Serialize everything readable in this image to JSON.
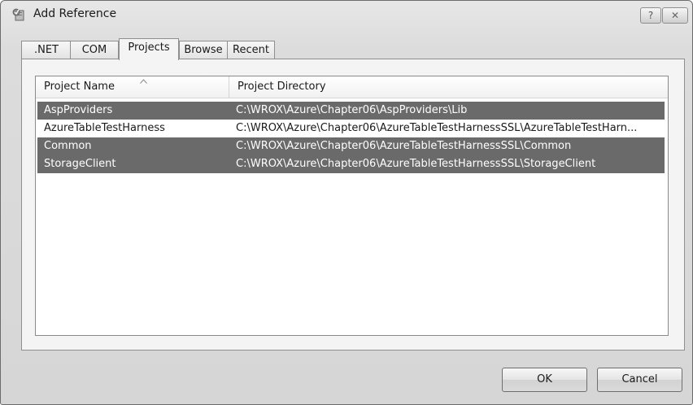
{
  "window": {
    "title": "Add Reference",
    "help_label": "?",
    "close_label": "✕"
  },
  "tabs": [
    {
      "label": ".NET",
      "active": false
    },
    {
      "label": "COM",
      "active": false
    },
    {
      "label": "Projects",
      "active": true
    },
    {
      "label": "Browse",
      "active": false
    },
    {
      "label": "Recent",
      "active": false
    }
  ],
  "list": {
    "columns": {
      "name": "Project Name",
      "directory": "Project Directory"
    },
    "rows": [
      {
        "name": "AspProviders",
        "directory": "C:\\WROX\\Azure\\Chapter06\\AspProviders\\Lib",
        "selected": true
      },
      {
        "name": "AzureTableTestHarness",
        "directory": "C:\\WROX\\Azure\\Chapter06\\AzureTableTestHarnessSSL\\AzureTableTestHarn...",
        "selected": false
      },
      {
        "name": "Common",
        "directory": "C:\\WROX\\Azure\\Chapter06\\AzureTableTestHarnessSSL\\Common",
        "selected": true
      },
      {
        "name": "StorageClient",
        "directory": "C:\\WROX\\Azure\\Chapter06\\AzureTableTestHarnessSSL\\StorageClient",
        "selected": true
      }
    ]
  },
  "buttons": {
    "ok": "OK",
    "cancel": "Cancel"
  },
  "icons": {
    "app": "add-reference-icon",
    "sort": "sort-ascending-icon"
  },
  "colors": {
    "selection": "#6a6a6a"
  }
}
